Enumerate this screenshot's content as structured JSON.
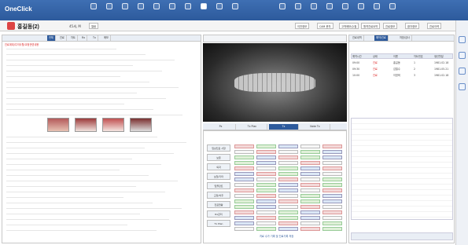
{
  "app": {
    "name": "OneClick"
  },
  "patient": {
    "name": "홍길동(2)",
    "info": "45세, M",
    "chart_btn": "열람"
  },
  "header_buttons": [
    "이전정보",
    "CAM 문자",
    "고객메모/수첩",
    "원격진료요약",
    "진료정보",
    "환자정보",
    "진료이력"
  ],
  "left_tabs": [
    "전체",
    "진료",
    "차트",
    "Rx",
    "Tx",
    "메모"
  ],
  "left_alert": "진료계획/주의사항/교정관련내용",
  "xray_tabs": [
    "Px",
    "Tx Plan",
    "Tx",
    "Note Tx"
  ],
  "right_tabs": [
    "진료내역",
    "예약/진료",
    "처방/검사"
  ],
  "right_table_headers": [
    "예약시간",
    "상태",
    "이름",
    "차트번호",
    "생년월일"
  ],
  "right_rows": [
    {
      "time": "09:00",
      "status": "진료",
      "name": "홍길동",
      "no": "1",
      "birth": "1981.02.18"
    },
    {
      "time": "09:30",
      "status": "진료",
      "name": "김철수",
      "no": "2",
      "birth": "1981.05.21"
    },
    {
      "time": "10:00",
      "status": "진료",
      "name": "이영희",
      "no": "3",
      "birth": "1981.02.18"
    }
  ],
  "side_buttons": [
    "임상진료 사항",
    "보존",
    "외과",
    "보철/기타",
    "임플란트",
    "교정/치주",
    "진료현황",
    "Rx관리",
    "Tx Plan"
  ],
  "bottom_note": "치료 수가 기록 및 진료기록 저장",
  "colors": {
    "topbar": "#2d5a9c",
    "accent": "#d22"
  }
}
